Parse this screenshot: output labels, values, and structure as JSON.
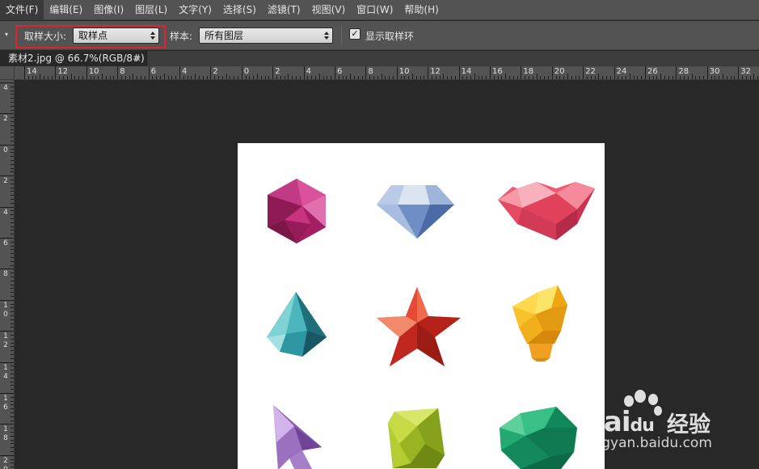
{
  "menu": {
    "items": [
      {
        "label": "文件(F)",
        "active": true
      },
      {
        "label": "编辑(E)"
      },
      {
        "label": "图像(I)"
      },
      {
        "label": "图层(L)"
      },
      {
        "label": "文字(Y)"
      },
      {
        "label": "选择(S)"
      },
      {
        "label": "滤镜(T)"
      },
      {
        "label": "视图(V)"
      },
      {
        "label": "窗口(W)"
      },
      {
        "label": "帮助(H)"
      }
    ]
  },
  "options": {
    "sample_size_label": "取样大小:",
    "sample_size_value": "取样点",
    "sample_label": "样本:",
    "sample_value": "所有图层",
    "show_ring_label": "显示取样环",
    "show_ring_checked": true
  },
  "document": {
    "tab_title": "素材2.jpg @ 66.7%(RGB/8#)",
    "close_glyph": "×"
  },
  "ruler": {
    "h_labels": [
      "14",
      "12",
      "10",
      "8",
      "6",
      "4",
      "2",
      "0",
      "2",
      "4",
      "6",
      "8",
      "10",
      "12",
      "14",
      "16",
      "18",
      "20",
      "22",
      "24",
      "26",
      "28",
      "30",
      "32"
    ],
    "v_labels": [
      [
        "4"
      ],
      [
        "2"
      ],
      [
        "0"
      ],
      [
        "2"
      ],
      [
        "4"
      ],
      [
        "6"
      ],
      [
        "8"
      ],
      [
        "1",
        "0"
      ],
      [
        "1",
        "2"
      ],
      [
        "1",
        "4"
      ],
      [
        "1",
        "6"
      ],
      [
        "1",
        "8"
      ],
      [
        "2",
        "0"
      ]
    ]
  },
  "canvas": {
    "icons": [
      "hexagon-gem-icon",
      "diamond-icon",
      "heart-gem-icon",
      "crystal-icon",
      "star-icon",
      "lightbulb-icon",
      "cursor-arrow-icon",
      "square-gem-icon",
      "speech-bubble-icon"
    ],
    "colors": {
      "magenta": "#b5246e",
      "blue": "#8aa5cf",
      "pink": "#ee5c74",
      "teal": "#2a8f9a",
      "red": "#d8322a",
      "yellow": "#f5b418",
      "purple": "#a77ec8",
      "lime": "#a9c22a",
      "green": "#18a06a"
    }
  },
  "watermark": {
    "brand": "Bai",
    "brand2": "du",
    "cn": "经验",
    "url": "jingyan.baidu.com"
  }
}
